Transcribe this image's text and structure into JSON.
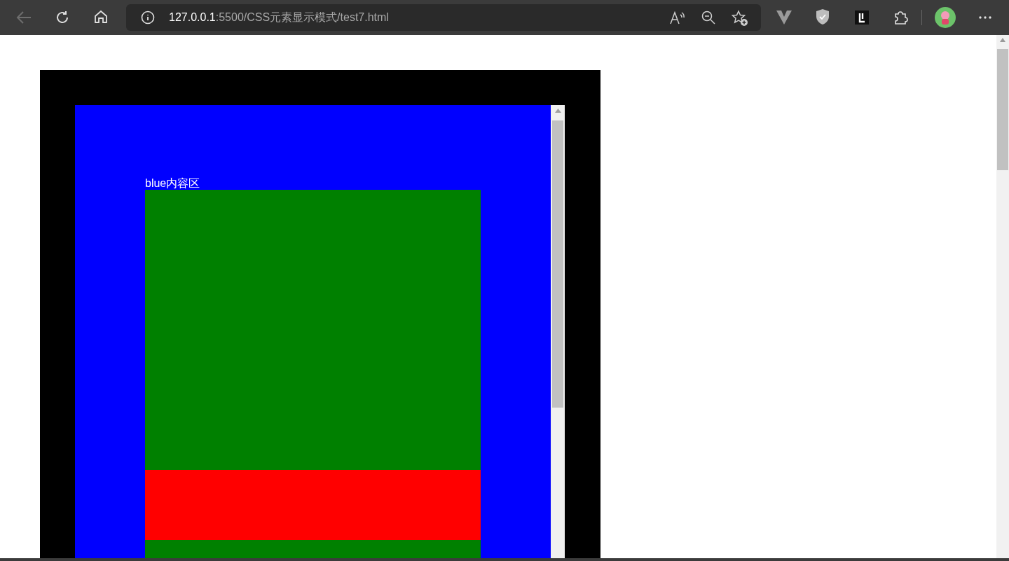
{
  "browser": {
    "url_host": "127.0.0.1",
    "url_path": ":5500/CSS元素显示模式/test7.html"
  },
  "page": {
    "label": "blue内容区",
    "blocks": [
      {
        "color": "#008000"
      },
      {
        "color": "#ff0000"
      },
      {
        "color": "#008000"
      }
    ]
  }
}
